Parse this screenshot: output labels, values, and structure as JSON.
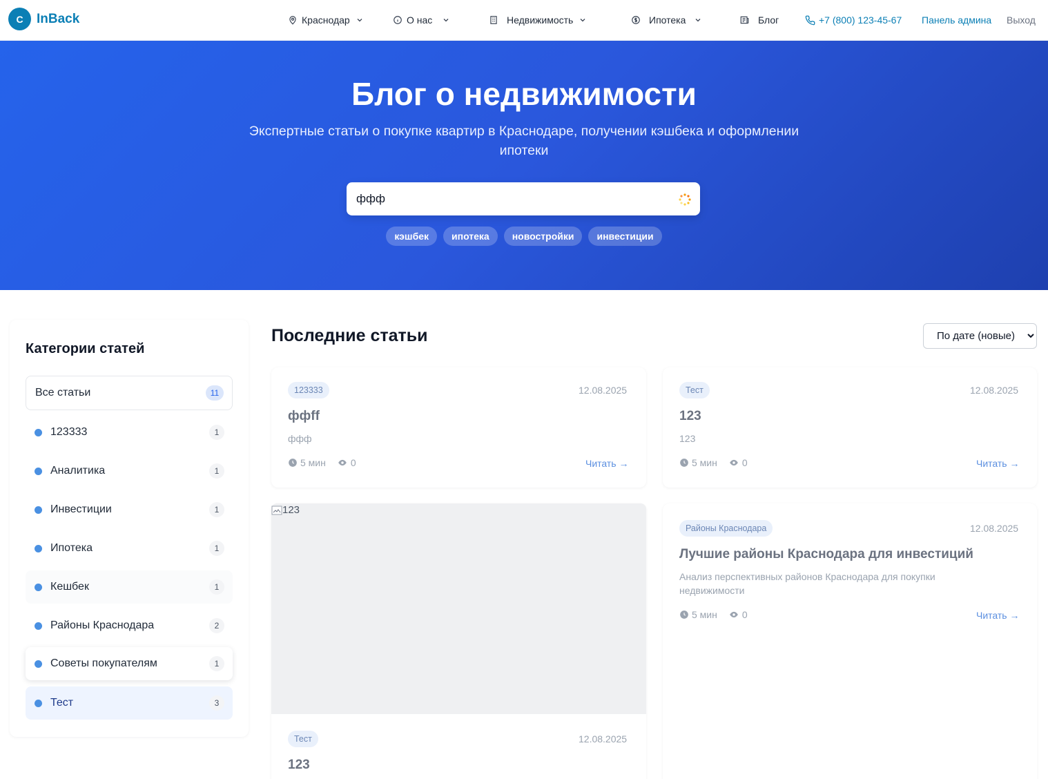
{
  "header": {
    "logo_letter": "C",
    "logo_text": "InBack",
    "nav": {
      "city": "Краснодар",
      "about": "О нас",
      "realty": "Недвижимость",
      "mortgage": "Ипотека",
      "blog": "Блог"
    },
    "phone": "+7 (800) 123-45-67",
    "admin": "Панель админа",
    "logout": "Выход",
    "accent_color": "#0b7fb5"
  },
  "hero": {
    "title": "Блог о недвижимости",
    "subtitle": "Экспертные статьи о покупке квартир в Краснодаре, получении кэшбека и оформлении ипотеки",
    "search_value": "ффф",
    "chips": [
      "кэшбек",
      "ипотека",
      "новостройки",
      "инвестиции"
    ],
    "bg_color": "#2563eb"
  },
  "sidebar": {
    "title": "Категории статей",
    "all": {
      "label": "Все статьи",
      "count": "11"
    },
    "items": [
      {
        "label": "123333",
        "count": "1"
      },
      {
        "label": "Аналитика",
        "count": "1"
      },
      {
        "label": "Инвестиции",
        "count": "1"
      },
      {
        "label": "Ипотека",
        "count": "1"
      },
      {
        "label": "Кешбек",
        "count": "1"
      },
      {
        "label": "Районы Краснодара",
        "count": "2"
      },
      {
        "label": "Советы покупателям",
        "count": "1"
      },
      {
        "label": "Тест",
        "count": "3"
      }
    ]
  },
  "main": {
    "title": "Последние статьи",
    "sort_selected": "По дате (новые)",
    "read_label": "Читать →",
    "articles": [
      {
        "tag": "123333",
        "date": "12.08.2025",
        "title": "ффff",
        "excerpt": "ффф",
        "time": "5 мин",
        "views": "0"
      },
      {
        "tag": "Тест",
        "date": "12.08.2025",
        "title": "123",
        "excerpt": "123",
        "time": "5 мин",
        "views": "0"
      },
      {
        "tag": "Тест",
        "date": "12.08.2025",
        "title": "123",
        "image_alt": "123"
      },
      {
        "tag": "Районы Краснодара",
        "date": "12.08.2025",
        "title": "Лучшие районы Краснодара для инвестиций",
        "excerpt": "Анализ перспективных районов Краснодара для покупки недвижимости",
        "time": "5 мин",
        "views": "0"
      }
    ]
  }
}
